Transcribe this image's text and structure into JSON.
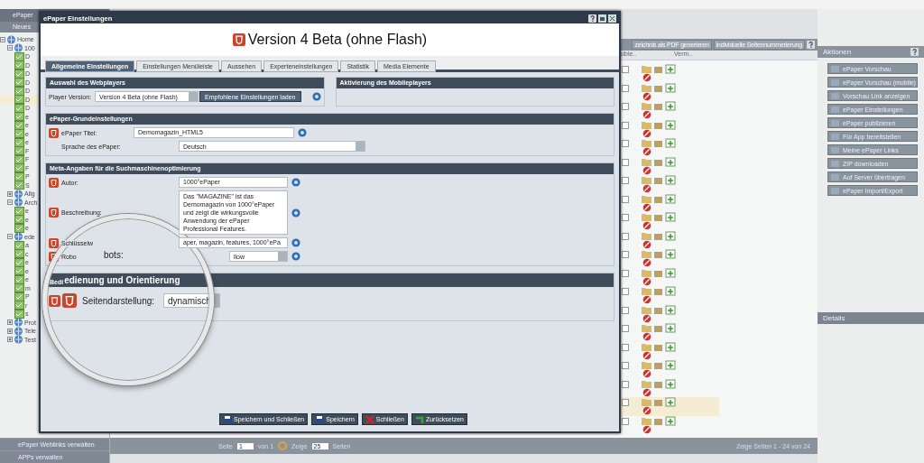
{
  "app": {
    "panel_title": "ePaper",
    "new_button": "Neues"
  },
  "tree": [
    {
      "label": "Home",
      "expanded": true,
      "children": [
        {
          "label": "100",
          "expanded": true,
          "children": [
            {
              "label": "D"
            },
            {
              "label": "D"
            },
            {
              "label": "D"
            },
            {
              "label": "D"
            },
            {
              "label": "D"
            },
            {
              "label": "D",
              "selected": true
            },
            {
              "label": "D"
            },
            {
              "label": "e"
            },
            {
              "label": "e"
            },
            {
              "label": "e"
            },
            {
              "label": "e"
            },
            {
              "label": "F"
            },
            {
              "label": "F"
            },
            {
              "label": "F"
            },
            {
              "label": "P"
            },
            {
              "label": "S"
            }
          ]
        },
        {
          "label": "Allg",
          "expanded": false
        },
        {
          "label": "Arch",
          "expanded": true,
          "children": [
            {
              "label": "e"
            },
            {
              "label": "e"
            },
            {
              "label": "e"
            }
          ]
        },
        {
          "label": "ede",
          "expanded": true,
          "children": [
            {
              "label": "a"
            },
            {
              "label": "c"
            },
            {
              "label": "e"
            },
            {
              "label": "e"
            },
            {
              "label": "e"
            },
            {
              "label": "m"
            },
            {
              "label": "P"
            },
            {
              "label": "r"
            },
            {
              "label": "s"
            }
          ]
        },
        {
          "label": "Prot",
          "expanded": false
        },
        {
          "label": "Tele",
          "expanded": false
        },
        {
          "label": "Test",
          "expanded": false
        }
      ]
    }
  ],
  "side_links": [
    "ePaper Weblinks verwalten",
    "APPs verwalten"
  ],
  "grid": {
    "toolbar": [
      "zeichnis als PDF generieren",
      "individuelle Seitennummerierung"
    ],
    "columns": [
      "sible..",
      "Verm.."
    ],
    "rows": [
      {
        "checked": false,
        "selected": false
      },
      {
        "checked": false,
        "selected": false
      },
      {
        "checked": false,
        "selected": false
      },
      {
        "checked": false,
        "selected": false
      },
      {
        "checked": false,
        "selected": false
      },
      {
        "checked": false,
        "selected": false
      },
      {
        "checked": false,
        "selected": false
      },
      {
        "checked": false,
        "selected": false
      },
      {
        "checked": false,
        "selected": false
      },
      {
        "checked": false,
        "selected": false
      },
      {
        "checked": false,
        "selected": false
      },
      {
        "checked": false,
        "selected": false
      },
      {
        "checked": false,
        "selected": false
      },
      {
        "checked": false,
        "selected": false
      },
      {
        "checked": false,
        "selected": false
      },
      {
        "checked": false,
        "selected": false
      },
      {
        "checked": false,
        "selected": false
      },
      {
        "checked": false,
        "selected": false
      },
      {
        "checked": false,
        "selected": true
      },
      {
        "checked": false,
        "selected": false
      }
    ],
    "pager": {
      "page_label": "Seite",
      "page": "1",
      "of": "von 1",
      "show_label": "Zeige",
      "per_page": "25",
      "pages_label": "Seiten",
      "summary": "Zeige Seiten 1 - 24 von 24"
    }
  },
  "actions": {
    "title": "Aktionen",
    "buttons": [
      "ePaper Vorschau",
      "ePaper Vorschau (mobile)",
      "Vorschau Link anzeigen",
      "ePaper Einstellungen",
      "ePaper publizieren",
      "Für App bereitstellen",
      "Meine ePaper Links",
      "ZIP downloaden",
      "Auf Server übertragen",
      "ePaper Import/Export"
    ]
  },
  "details": {
    "title": "Details"
  },
  "dialog": {
    "title": "ePaper Einstellungen",
    "heading": "Version 4 Beta (ohne Flash)",
    "tabs": [
      {
        "label": "Allgemeine Einstellungen",
        "selected": true
      },
      {
        "label": "Einstellungen Menüleiste",
        "selected": false
      },
      {
        "label": "Aussehen",
        "selected": false
      },
      {
        "label": "Experteneinstellungen",
        "selected": false
      },
      {
        "label": "Statistik",
        "selected": false
      },
      {
        "label": "Media Elemente",
        "selected": false
      }
    ],
    "webplayer": {
      "title": "Auswahl des Webplayers",
      "label": "Player Version:",
      "value": "Version 4 Beta (ohne Flash)",
      "load_button": "Empfohlene Einstellungen laden"
    },
    "mobile": {
      "title": "Aktivierung des Mobileplayers"
    },
    "basic": {
      "title": "ePaper-Grundeinstellungen",
      "fields": [
        {
          "label": "ePaper Titel:",
          "value": "Demomagazin_HTML5",
          "kind": "text",
          "html5": true,
          "help": true
        },
        {
          "label": "Sprache des ePaper:",
          "value": "Deutsch",
          "kind": "select",
          "html5": false,
          "help": false
        }
      ]
    },
    "meta": {
      "title": "Meta-Angaben für die Suchmaschinenoptimierung",
      "fields": [
        {
          "label": "Autor:",
          "value": "1000°ePaper",
          "kind": "text",
          "html5": true,
          "help": true
        },
        {
          "label": "Beschreibung:",
          "value": "Das \"MAGAZINE\" ist das Demomagazin von 1000°ePaper und zeigt die wirkungsvolle Anwendung der ePaper Professional Features.",
          "kind": "textarea",
          "html5": true,
          "help": true
        },
        {
          "label": "Schlüsselw",
          "value": "aper, magazin, features, 1000°ePa",
          "kind": "text",
          "html5": true,
          "help": true
        },
        {
          "label": "Robo",
          "value": "llow",
          "kind": "select",
          "html5": true,
          "help": true
        }
      ]
    },
    "lens": {
      "robots_label": "bots:",
      "small_heading": "Bedi",
      "heading": "edienung und Orientierung",
      "label": "Seitendarstellung:",
      "value": "dynamisch"
    },
    "buttons": [
      {
        "label": "Speichern und Schließen",
        "kind": "save"
      },
      {
        "label": "Speichern",
        "kind": "save"
      },
      {
        "label": "Schließen",
        "kind": "close"
      },
      {
        "label": "Zurücksetzen",
        "kind": "reset"
      }
    ]
  }
}
